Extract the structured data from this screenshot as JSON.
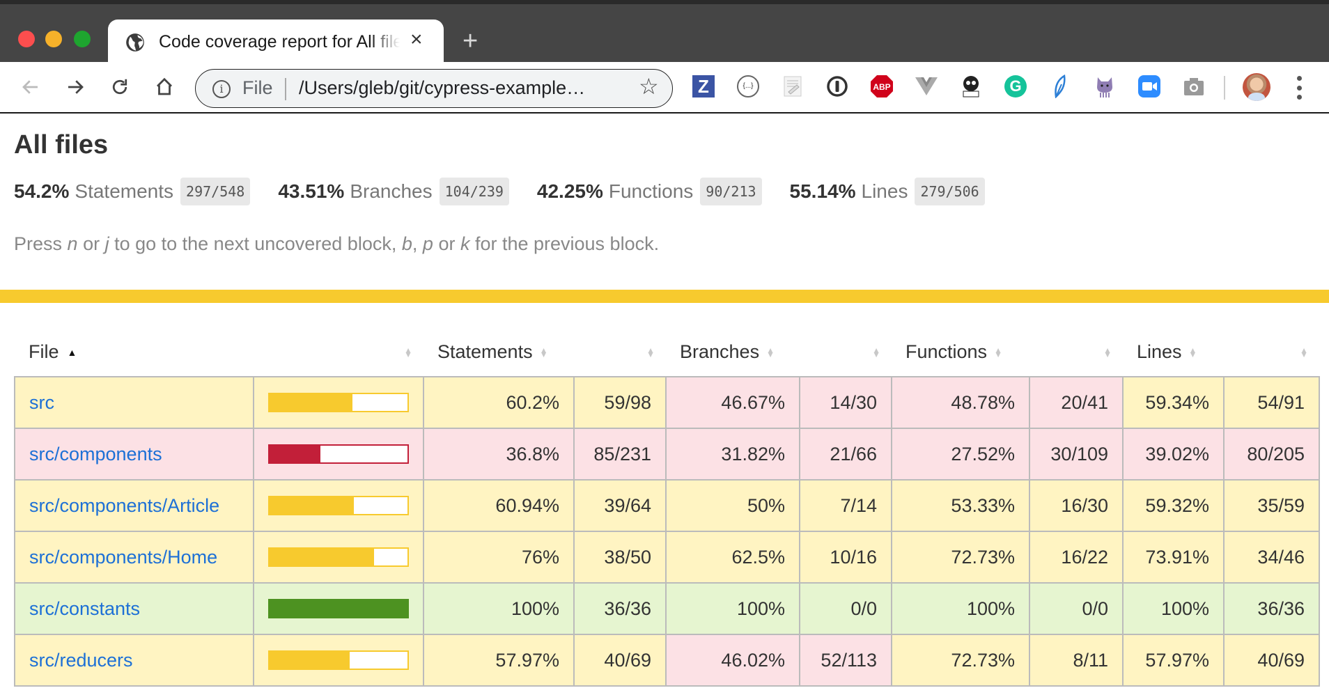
{
  "browser": {
    "tab_title": "Code coverage report for All files",
    "tab_close": "×",
    "new_tab": "+",
    "address": {
      "scheme_label": "File",
      "url": "/Users/gleb/git/cypress-example…",
      "info_icon": "i",
      "bookmark_icon": "☆"
    },
    "nav": {
      "back": "←",
      "forward": "→",
      "reload": "↻",
      "home": "⌂"
    },
    "extensions": [
      {
        "name": "zotero-extension-icon",
        "label": "Z"
      },
      {
        "name": "json-formatter-icon",
        "label": "{...}"
      },
      {
        "name": "notes-extension-icon",
        "label": ""
      },
      {
        "name": "1password-icon",
        "label": ""
      },
      {
        "name": "adblock-plus-icon",
        "label": "ABP"
      },
      {
        "name": "vue-devtools-icon",
        "label": ""
      },
      {
        "name": "kuker-icon",
        "label": ""
      },
      {
        "name": "grammarly-icon",
        "label": "G"
      },
      {
        "name": "feather-extension-icon",
        "label": ""
      },
      {
        "name": "octocat-extension-icon",
        "label": ""
      },
      {
        "name": "zoom-icon",
        "label": ""
      },
      {
        "name": "screenshot-camera-icon",
        "label": ""
      }
    ]
  },
  "report": {
    "heading": "All files",
    "summary": [
      {
        "pct": "54.2%",
        "label": "Statements",
        "fraction": "297/548"
      },
      {
        "pct": "43.51%",
        "label": "Branches",
        "fraction": "104/239"
      },
      {
        "pct": "42.25%",
        "label": "Functions",
        "fraction": "90/213"
      },
      {
        "pct": "55.14%",
        "label": "Lines",
        "fraction": "279/506"
      }
    ],
    "hint": {
      "p1": "Press ",
      "k1": "n",
      "p2": " or ",
      "k2": "j",
      "p3": " to go to the next uncovered block, ",
      "k3": "b",
      "p4": ", ",
      "k4": "p",
      "p5": " or ",
      "k5": "k",
      "p6": " for the previous block."
    },
    "overall_status_color": "#f7ca2e",
    "table": {
      "headers": {
        "file": "File",
        "statements": "Statements",
        "branches": "Branches",
        "functions": "Functions",
        "lines": "Lines"
      },
      "sort": {
        "column": "File",
        "direction": "ascending"
      },
      "colors": {
        "low_bg": "#fce1e5",
        "medium_bg": "#fff4c2",
        "high_bg": "#e6f5d0",
        "low_bar": "#c21f39",
        "medium_bar": "#f7ca2e",
        "high_bar": "#4d9221",
        "link": "#1d70d6"
      },
      "rows": [
        {
          "file": "src",
          "bar_level": "medium",
          "coverage_fraction": 0.602,
          "statements": {
            "pct": "60.2%",
            "frac": "59/98",
            "level": "medium"
          },
          "branches": {
            "pct": "46.67%",
            "frac": "14/30",
            "level": "low"
          },
          "functions": {
            "pct": "48.78%",
            "frac": "20/41",
            "level": "low"
          },
          "lines": {
            "pct": "59.34%",
            "frac": "54/91",
            "level": "medium"
          }
        },
        {
          "file": "src/components",
          "bar_level": "low",
          "coverage_fraction": 0.368,
          "statements": {
            "pct": "36.8%",
            "frac": "85/231",
            "level": "low"
          },
          "branches": {
            "pct": "31.82%",
            "frac": "21/66",
            "level": "low"
          },
          "functions": {
            "pct": "27.52%",
            "frac": "30/109",
            "level": "low"
          },
          "lines": {
            "pct": "39.02%",
            "frac": "80/205",
            "level": "low"
          }
        },
        {
          "file": "src/components/Article",
          "bar_level": "medium",
          "coverage_fraction": 0.6094,
          "statements": {
            "pct": "60.94%",
            "frac": "39/64",
            "level": "medium"
          },
          "branches": {
            "pct": "50%",
            "frac": "7/14",
            "level": "medium"
          },
          "functions": {
            "pct": "53.33%",
            "frac": "16/30",
            "level": "medium"
          },
          "lines": {
            "pct": "59.32%",
            "frac": "35/59",
            "level": "medium"
          }
        },
        {
          "file": "src/components/Home",
          "bar_level": "medium",
          "coverage_fraction": 0.76,
          "statements": {
            "pct": "76%",
            "frac": "38/50",
            "level": "medium"
          },
          "branches": {
            "pct": "62.5%",
            "frac": "10/16",
            "level": "medium"
          },
          "functions": {
            "pct": "72.73%",
            "frac": "16/22",
            "level": "medium"
          },
          "lines": {
            "pct": "73.91%",
            "frac": "34/46",
            "level": "medium"
          }
        },
        {
          "file": "src/constants",
          "bar_level": "high",
          "coverage_fraction": 1.0,
          "statements": {
            "pct": "100%",
            "frac": "36/36",
            "level": "high"
          },
          "branches": {
            "pct": "100%",
            "frac": "0/0",
            "level": "high"
          },
          "functions": {
            "pct": "100%",
            "frac": "0/0",
            "level": "high"
          },
          "lines": {
            "pct": "100%",
            "frac": "36/36",
            "level": "high"
          }
        },
        {
          "file": "src/reducers",
          "bar_level": "medium",
          "coverage_fraction": 0.5797,
          "statements": {
            "pct": "57.97%",
            "frac": "40/69",
            "level": "medium"
          },
          "branches": {
            "pct": "46.02%",
            "frac": "52/113",
            "level": "low"
          },
          "functions": {
            "pct": "72.73%",
            "frac": "8/11",
            "level": "medium"
          },
          "lines": {
            "pct": "57.97%",
            "frac": "40/69",
            "level": "medium"
          }
        }
      ]
    }
  }
}
